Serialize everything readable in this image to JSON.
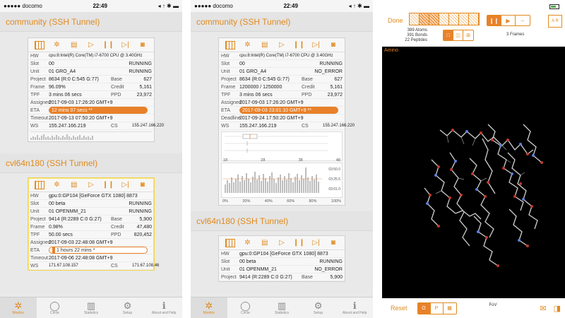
{
  "status_bar": {
    "carrier": "●●●●● docomo",
    "time": "22:49",
    "right": "◂ ↑ ✱ ▬"
  },
  "panel1": {
    "section1_title": "community (SSH Tunnel)",
    "card1": {
      "rows": [
        {
          "k": "HW",
          "v": "cpu:8:Intel(R) Core(TM) i7-6700 CPU @ 3.40GHz",
          "r": ""
        },
        {
          "k": "Slot",
          "v": "00",
          "r": "RUNNING"
        },
        {
          "k": "Unit",
          "v": "01   GRO_A4",
          "r": "RUNNING"
        }
      ],
      "rows4": [
        {
          "k": "Project",
          "v": "8634 (R:0 C:545 G:77)",
          "k2": "Base",
          "v2": "627"
        },
        {
          "k": "Frame",
          "v": "96.09%",
          "k2": "Credit",
          "v2": "5,161"
        },
        {
          "k": "TPF",
          "v": "3 mins 06 secs",
          "k2": "PPD",
          "v2": "23,972"
        }
      ],
      "assigned": "2017-09-03 17:26:20 GMT+9",
      "eta": "12 mins 07 secs **",
      "timeout": "2017-09-13 07:50:20 GMT+9",
      "ws": "155.247.166.219",
      "cs": "155.247.166.220"
    },
    "section2_title": "cvl64n180 (SSH Tunnel)",
    "card2": {
      "rows": [
        {
          "k": "HW",
          "v": "gpu:0:GP104 [GeForce GTX 1080] 8873",
          "r": ""
        },
        {
          "k": "Slot",
          "v": "00   beta",
          "r": "RUNNING"
        },
        {
          "k": "Unit",
          "v": "01   OPENMM_21",
          "r": "RUNNING"
        }
      ],
      "rows4": [
        {
          "k": "Project",
          "v": "9414 (R:2289 C:0 G:27)",
          "k2": "Base",
          "v2": "5,900"
        },
        {
          "k": "Frame",
          "v": "0.98%",
          "k2": "Credit",
          "v2": "47,480"
        },
        {
          "k": "TPF",
          "v": "50.00 secs",
          "k2": "PPD",
          "v2": "820,452"
        }
      ],
      "assigned": "2017-09-03 22:48:08 GMT+9",
      "eta": "1 hours 22 mins *",
      "timeout": "2017-09-06 22:48:08 GMT+9",
      "ws": "171.67.108.157",
      "cs": "171.67.108.46"
    }
  },
  "panel2": {
    "section1_title": "community (SSH Tunnel)",
    "card1": {
      "rows": [
        {
          "k": "HW",
          "v": "cpu:8:Intel(R) Core(TM) i7-6700 CPU @ 3.40GHz",
          "r": ""
        },
        {
          "k": "Slot",
          "v": "00",
          "r": "RUNNING"
        },
        {
          "k": "Unit",
          "v": "01   GRO_A4",
          "r": "NO_ERROR"
        }
      ],
      "rows4": [
        {
          "k": "Project",
          "v": "8634 (R:0 C:545 G:77)",
          "k2": "Base",
          "v2": "627"
        },
        {
          "k": "Frame",
          "v": "1200000 / 1250000",
          "k2": "Credit",
          "v2": "5,161"
        },
        {
          "k": "TPF",
          "v": "3 mins 06 secs",
          "k2": "PPD",
          "v2": "23,972"
        }
      ],
      "assigned": "2017-09-03 17:26:20 GMT+9",
      "eta": "2017-09-03 23:01:10 GMT+9 **",
      "deadline": "2017-09-24 17:50:20 GMT+9",
      "ws": "155.247.166.219",
      "cs": "155.247.166.220",
      "box_axis": [
        "18",
        "28",
        "38",
        "48"
      ],
      "hist_axis_y": [
        "03:50.0",
        "03:25.5",
        "03:01.0"
      ],
      "hist_axis_x": [
        "0%",
        "20%",
        "40%",
        "60%",
        "80%",
        "100%"
      ]
    },
    "section2_title": "cvl64n180 (SSH Tunnel)",
    "card2": {
      "rows": [
        {
          "k": "HW",
          "v": "gpu:0:GP104 [GeForce GTX 1080] 8873",
          "r": ""
        },
        {
          "k": "Slot",
          "v": "00   beta",
          "r": "RUNNING"
        },
        {
          "k": "Unit",
          "v": "01   OPENMM_21",
          "r": "NO_ERROR"
        }
      ],
      "project": {
        "k": "Project",
        "v": "9414 (R:2289 C:0 G:27)",
        "k2": "Base",
        "v2": "5,900"
      }
    }
  },
  "tabs": [
    "Monitor",
    "Circle",
    "Statistics",
    "Setup",
    "About and Help"
  ],
  "panel3": {
    "done": "Done",
    "atoms": "389 Atoms",
    "bonds": "391 Bonds",
    "peptides": "22 Peptides",
    "frames": "3 Frames",
    "amino": "Amino",
    "reset": "Reset",
    "mode_o": "O",
    "mode_p": "P",
    "fov": "FoV",
    "ar": "A R"
  }
}
